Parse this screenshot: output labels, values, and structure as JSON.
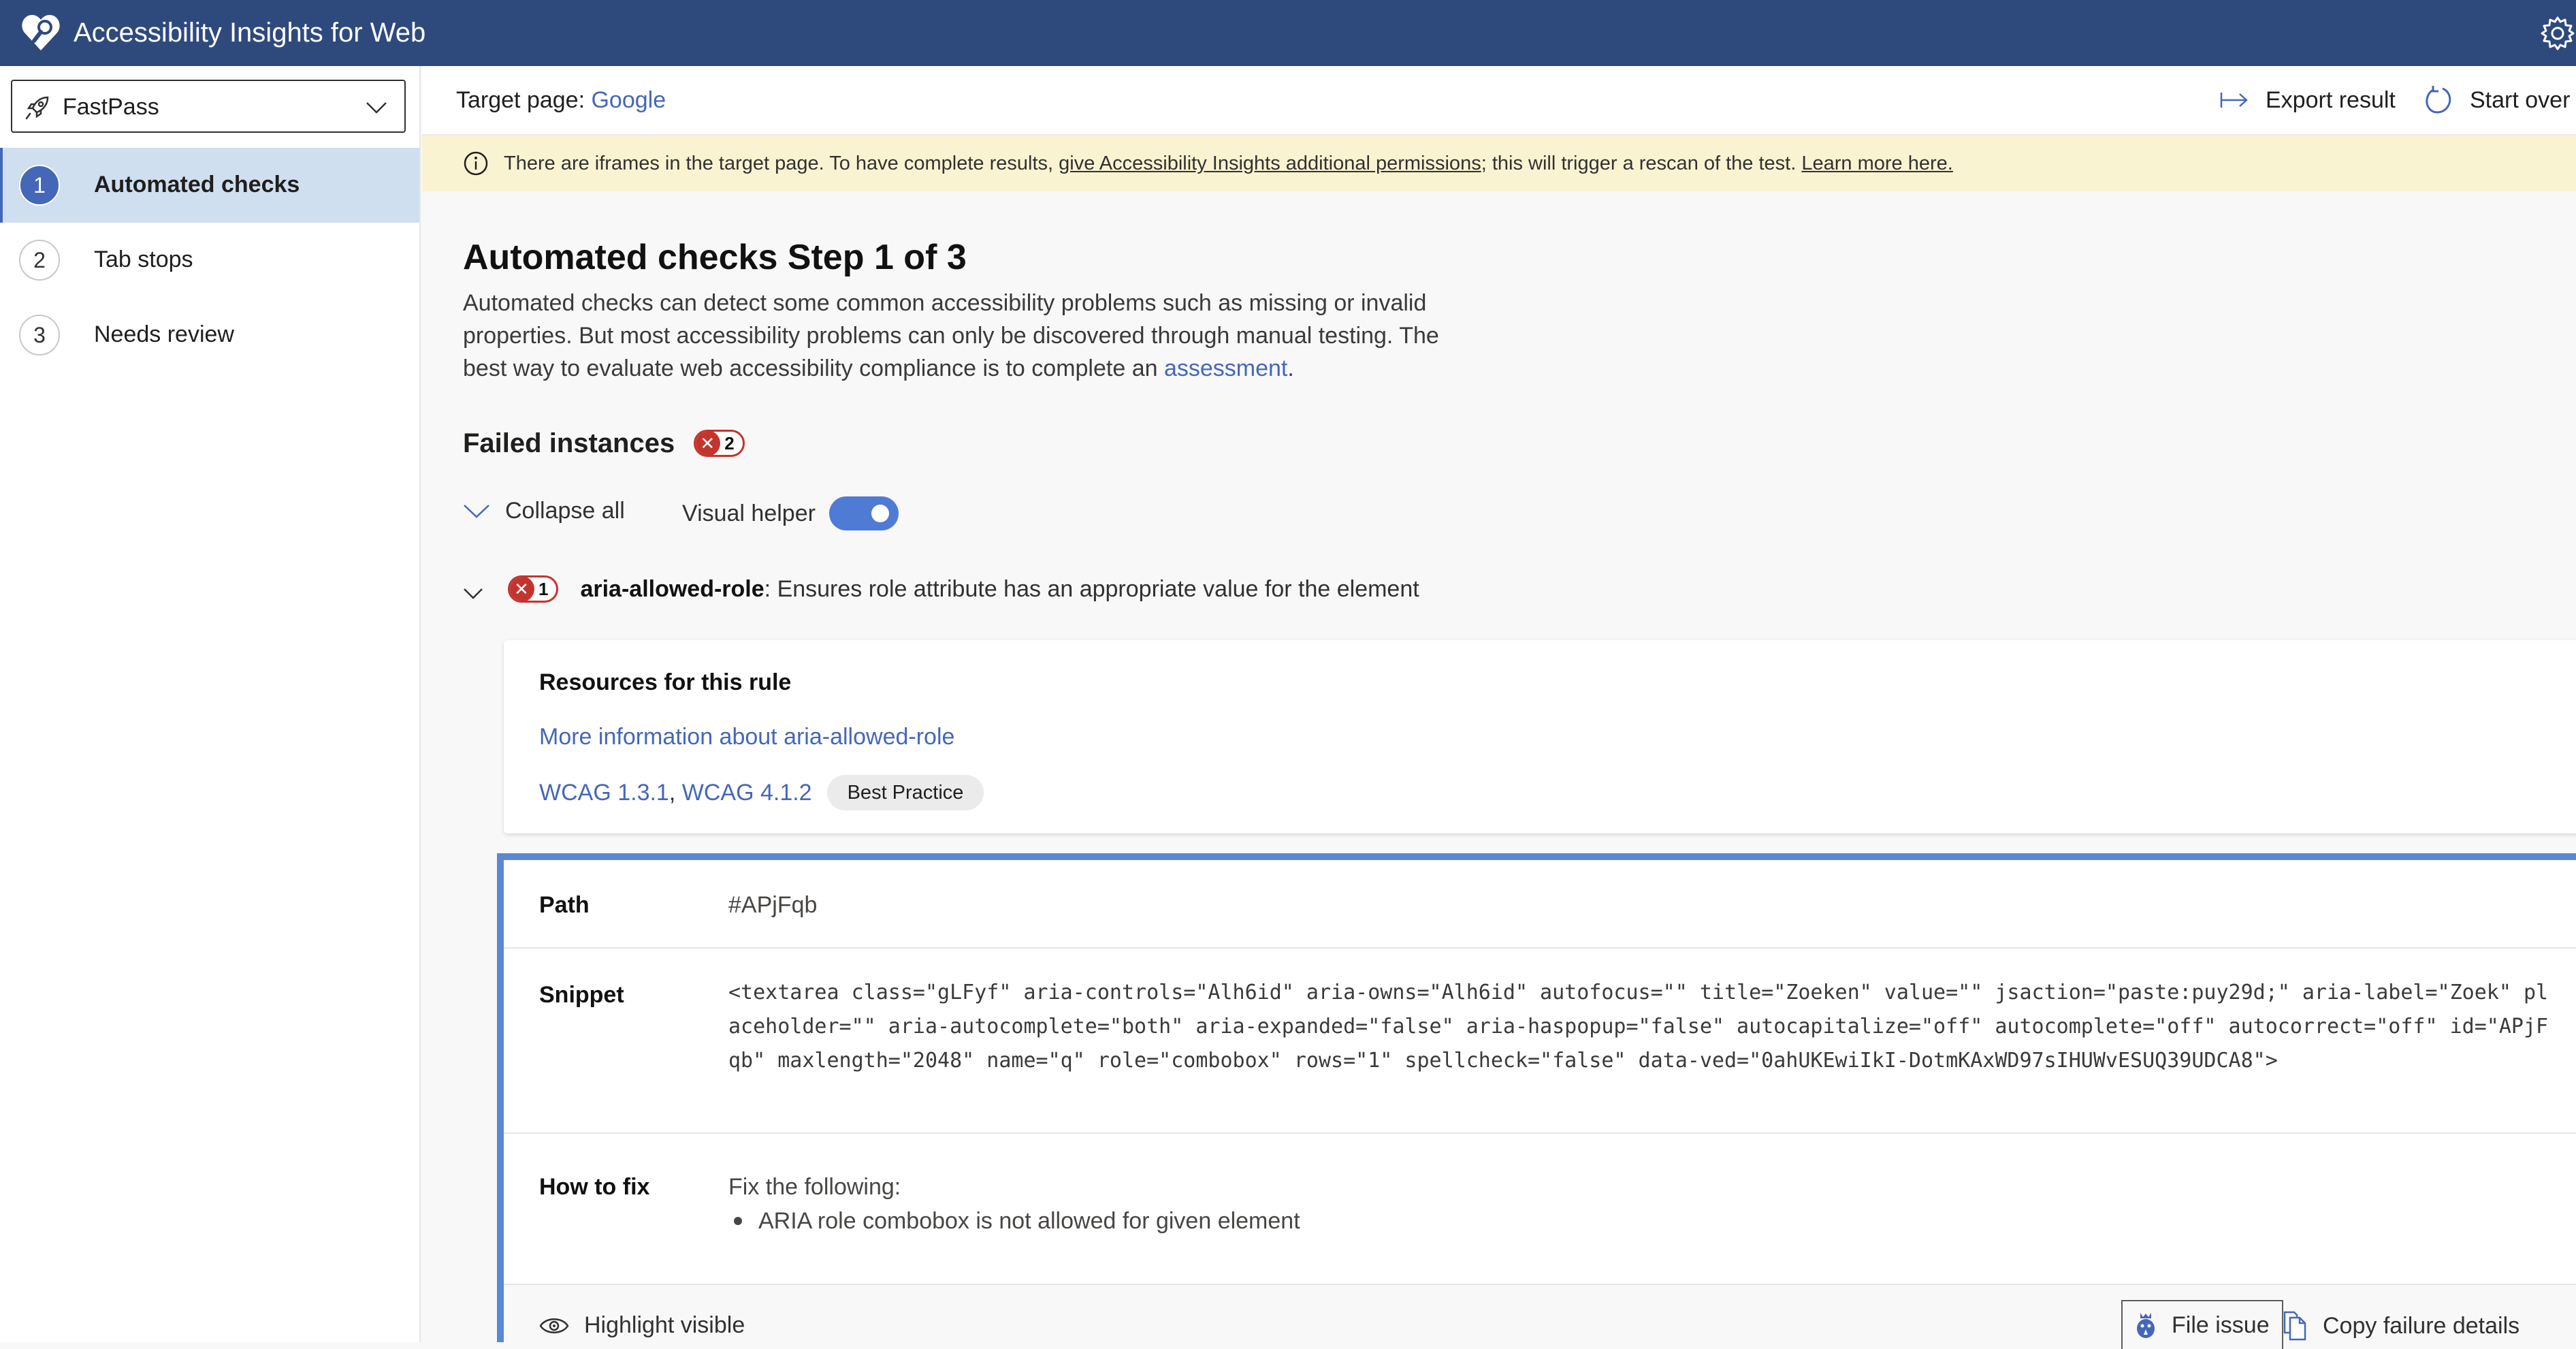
{
  "app": {
    "title": "Accessibility Insights for Web"
  },
  "sidebar": {
    "mode_select": {
      "value": "FastPass"
    },
    "items": [
      {
        "number": "1",
        "label": "Automated checks",
        "active": true
      },
      {
        "number": "2",
        "label": "Tab stops",
        "active": false
      },
      {
        "number": "3",
        "label": "Needs review",
        "active": false
      }
    ]
  },
  "command_bar": {
    "target_label": "Target page:",
    "target_value": "Google",
    "export_label": "Export result",
    "start_over_label": "Start over"
  },
  "banner": {
    "text_before": "There are iframes in the target page. To have complete results, ",
    "permissions_link": "give Accessibility Insights additional permissions",
    "text_middle": "; this will trigger a rescan of the test. ",
    "learn_more_link": "Learn more here."
  },
  "main": {
    "title": "Automated checks Step 1 of 3",
    "description_before": "Automated checks can detect some common accessibility problems such as missing or invalid properties. But most accessibility problems can only be discovered through manual testing. The best way to evaluate web accessibility compliance is to complete an ",
    "description_link": "assessment",
    "description_after": ".",
    "failed_heading": "Failed instances",
    "failed_count": "2",
    "collapse_all_label": "Collapse all",
    "visual_helper_label": "Visual helper",
    "visual_helper_on": true
  },
  "rule": {
    "count": "1",
    "id": "aria-allowed-role",
    "description": ": Ensures role attribute has an appropriate value for the element",
    "resources": {
      "title": "Resources for this rule",
      "more_info_link": "More information about aria-allowed-role",
      "wcag_links": [
        "WCAG 1.3.1",
        "WCAG 4.1.2"
      ],
      "separator": ", ",
      "tag": "Best Practice"
    }
  },
  "instance": {
    "path_label": "Path",
    "path_value": "#APjFqb",
    "snippet_label": "Snippet",
    "snippet_value": "<textarea class=\"gLFyf\" aria-controls=\"Alh6id\" aria-owns=\"Alh6id\" autofocus=\"\" title=\"Zoeken\" value=\"\" jsaction=\"paste:puy29d;\" aria-label=\"Zoek\" placeholder=\"\" aria-autocomplete=\"both\" aria-expanded=\"false\" aria-haspopup=\"false\" autocapitalize=\"off\" autocomplete=\"off\" autocorrect=\"off\" id=\"APjFqb\" maxlength=\"2048\" name=\"q\" role=\"combobox\" rows=\"1\" spellcheck=\"false\" data-ved=\"0ahUKEwiIkI-DotmKAxWD97sIHUWvESUQ39UDCA8\">",
    "fix_label": "How to fix",
    "fix_intro": "Fix the following:",
    "fix_items": [
      "ARIA role combobox is not allowed for given element"
    ],
    "highlight_label": "Highlight visible",
    "file_issue_label": "File issue",
    "copy_details_label": "Copy failure details"
  },
  "colors": {
    "titlebar": "#2e4a7d",
    "accent": "#4467b8",
    "fail": "#c4342e",
    "banner": "#faf3d2",
    "instance_border": "#5b88d4"
  }
}
